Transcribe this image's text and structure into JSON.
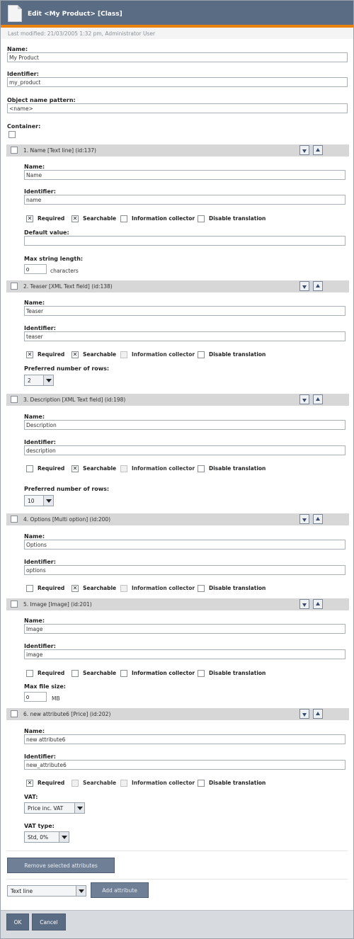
{
  "header": {
    "title": "Edit <My Product> [Class]",
    "modified": "Last modified: 21/03/2005 1:32 pm, Administrator User"
  },
  "fields": {
    "name_label": "Name:",
    "name_value": "My Product",
    "identifier_label": "Identifier:",
    "identifier_value": "my_product",
    "pattern_label": "Object name pattern:",
    "pattern_value": "<name>",
    "container_label": "Container:"
  },
  "labels": {
    "name": "Name:",
    "identifier": "Identifier:",
    "required": "Required",
    "searchable": "Searchable",
    "info_collector": "Information collector",
    "disable_translation": "Disable translation",
    "default_value": "Default value:",
    "max_string_length": "Max string length:",
    "characters": "characters",
    "preferred_rows": "Preferred number of rows:",
    "max_file_size": "Max file size:",
    "mb": "MB",
    "vat": "VAT:",
    "vat_type": "VAT type:"
  },
  "attributes": [
    {
      "title": "1. Name [Text line] (id:137)",
      "name": "Name",
      "identifier": "name",
      "required": true,
      "searchable": true,
      "extra": {
        "default_value": "",
        "max_length": "0"
      }
    },
    {
      "title": "2. Teaser [XML Text field] (id:138)",
      "name": "Teaser",
      "identifier": "teaser",
      "required": true,
      "searchable": true,
      "extra": {
        "rows": "2"
      }
    },
    {
      "title": "3. Description [XML Text field] (id:198)",
      "name": "Description",
      "identifier": "description",
      "required": false,
      "searchable": true,
      "extra": {
        "rows": "10"
      }
    },
    {
      "title": "4. Options [Multi option] (id:200)",
      "name": "Options",
      "identifier": "options",
      "required": false,
      "searchable": true
    },
    {
      "title": "5. Image [Image] (id:201)",
      "name": "Image",
      "identifier": "image",
      "required": false,
      "searchable": false,
      "extra": {
        "max_file_size": "0"
      }
    },
    {
      "title": "6. new attribute6 [Price] (id:202)",
      "name": "new attribute6",
      "identifier": "new_attribute6",
      "required": true,
      "searchable": false,
      "extra": {
        "vat": "Price inc. VAT",
        "vat_type": "Std, 0%"
      }
    }
  ],
  "buttons": {
    "remove_selected": "Remove selected attributes",
    "datatype_select": "Text line",
    "add_attribute": "Add attribute",
    "ok": "OK",
    "cancel": "Cancel"
  }
}
